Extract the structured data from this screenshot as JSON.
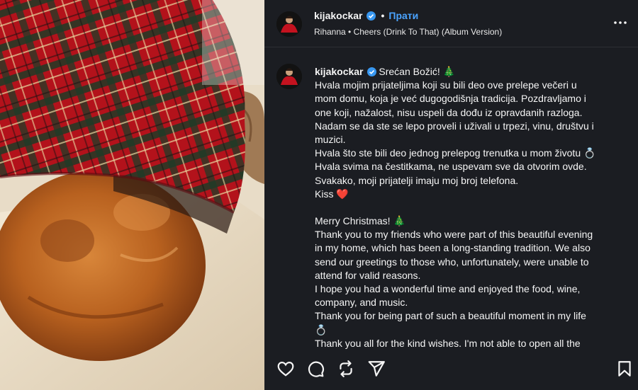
{
  "header": {
    "username": "kijakockar",
    "separator": "•",
    "follow_label": "Прати",
    "song": "Rihanna • Cheers (Drink To That) (Album Version)",
    "more_icon": "more-options-icon"
  },
  "caption": {
    "username": "kijakockar",
    "lines": [
      "Srećan Božić! 🎄",
      "Hvala mojim prijateljima koji su bili deo ove prelepe večeri u",
      "mom domu, koja je već dugogodišnja tradicija. Pozdravljamo i",
      "one koji, nažalost, nisu uspeli da dođu iz opravdanih razloga.",
      "Nadam se da ste se lepo proveli i uživali u trpezi, vinu, društvu i",
      "muzici.",
      "Hvala što ste bili deo jednog prelepog trenutka u mom životu 💍",
      "Hvala svima na čestitkama, ne uspevam sve da otvorim ovde.",
      "Svakako, moji prijatelji imaju moj broj telefona.",
      "Kiss ❤️",
      "",
      "Merry Christmas! 🎄",
      "Thank you to my friends who were part of this beautiful evening",
      "in my home, which has been a long-standing tradition. We also",
      "send our greetings to those who, unfortunately, were unable to",
      "attend for valid reasons.",
      "I hope you had a wonderful time and enjoyed the food, wine,",
      "company, and music.",
      "Thank you for being part of such a beautiful moment in my life",
      "💍",
      "Thank you all for the kind wishes. I'm not able to open all the"
    ]
  },
  "actions": {
    "like_icon": "heart-icon",
    "comment_icon": "comment-icon",
    "repost_icon": "repost-icon",
    "share_icon": "share-icon",
    "save_icon": "bookmark-icon"
  },
  "colors": {
    "panel_bg": "#1b1d22",
    "accent": "#4aa3ff",
    "text": "#f5f5f5"
  }
}
